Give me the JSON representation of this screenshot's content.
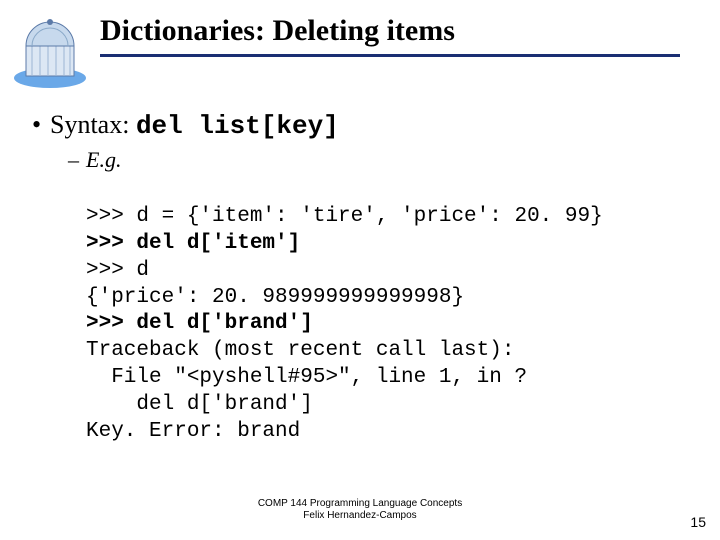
{
  "title": "Dictionaries: Deleting items",
  "syntax": {
    "label": "Syntax: ",
    "code": "del list[key]"
  },
  "eg_label": "E.g.",
  "code_lines": [
    ">>> d = {'item': 'tire', 'price': 20. 99}",
    ">>> del d['item']",
    ">>> d",
    "{'price': 20. 989999999999998}",
    ">>> del d['brand']",
    "Traceback (most recent call last):",
    "  File \"<pyshell#95>\", line 1, in ?",
    "    del d['brand']",
    "Key. Error: brand"
  ],
  "footer_line1": "COMP 144 Programming Language Concepts",
  "footer_line2": "Felix Hernandez-Campos",
  "page_number": "15",
  "colors": {
    "accent": "#1a2f73"
  }
}
